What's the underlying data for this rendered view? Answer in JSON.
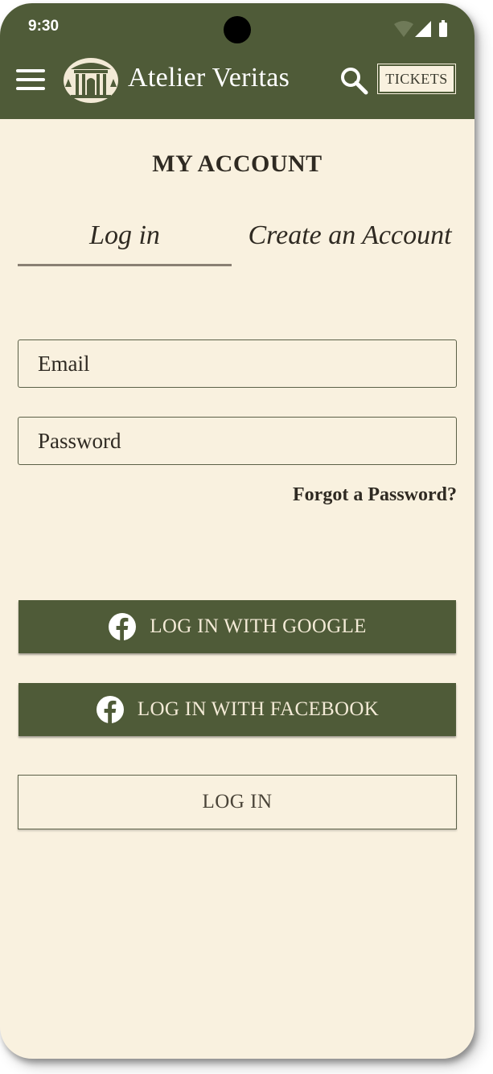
{
  "status_bar": {
    "time": "9:30"
  },
  "header": {
    "brand": "Atelier Veritas",
    "tickets_label": "TICKETS"
  },
  "page": {
    "title": "MY ACCOUNT"
  },
  "tabs": [
    {
      "label": "Log in",
      "active": true
    },
    {
      "label": "Create an Account",
      "active": false
    }
  ],
  "form": {
    "email_placeholder": "Email",
    "password_placeholder": "Password",
    "forgot_label": "Forgot a Password?"
  },
  "buttons": {
    "google_label": "LOG IN WITH GOOGLE",
    "facebook_label": "LOG IN WITH FACEBOOK",
    "login_label": "LOG IN"
  },
  "icons": [
    "menu-icon",
    "museum-logo-icon",
    "search-icon",
    "facebook-icon",
    "wifi-icon",
    "signal-icon",
    "battery-icon"
  ],
  "colors": {
    "header": "#4f5b38",
    "background": "#f9f1df",
    "text": "#2f2a22"
  }
}
